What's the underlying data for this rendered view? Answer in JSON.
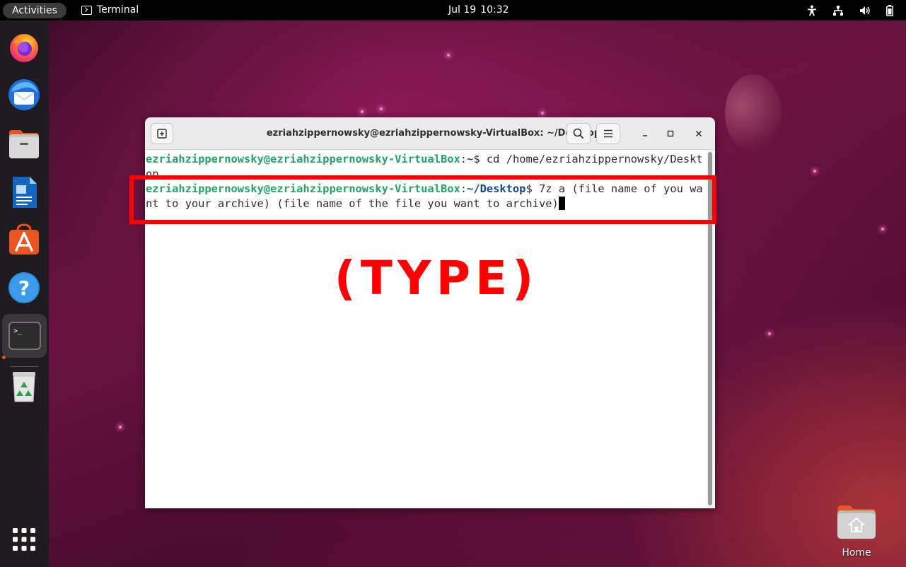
{
  "topbar": {
    "activities": "Activities",
    "app_name": "Terminal",
    "date": "Jul 19",
    "time": "10:32"
  },
  "dock": {
    "apps": [
      {
        "name": "firefox-icon"
      },
      {
        "name": "thunderbird-icon"
      },
      {
        "name": "files-icon"
      },
      {
        "name": "libreoffice-writer-icon"
      },
      {
        "name": "ubuntu-software-icon"
      },
      {
        "name": "help-icon"
      },
      {
        "name": "terminal-icon",
        "active": true
      },
      {
        "name": "trash-icon"
      },
      {
        "name": "show-applications-icon"
      }
    ]
  },
  "window": {
    "title": "ezriahzippernowsky@ezriahzippernowsky-VirtualBox: ~/Desktop"
  },
  "terminal": {
    "line1": {
      "user_host": "ezriahzippernowsky@ezriahzippernowsky-VirtualBox",
      "sep": ":",
      "path": "~",
      "prompt": "$ ",
      "command": "cd /home/ezriahzippernowsky/Desktop"
    },
    "line2": {
      "user_host": "ezriahzippernowsky@ezriahzippernowsky-VirtualBox",
      "sep": ":",
      "path": "~/Desktop",
      "prompt": "$ ",
      "command": "7z a (file name of you want to your archive) (file name of the file you want to archive)"
    }
  },
  "annotation": {
    "label": "(TYPE)",
    "color": "#ff0000"
  },
  "desktop": {
    "home_label": "Home"
  },
  "colors": {
    "prompt_user": "#26a269",
    "prompt_path": "#12488b",
    "accent": "#e95420"
  }
}
